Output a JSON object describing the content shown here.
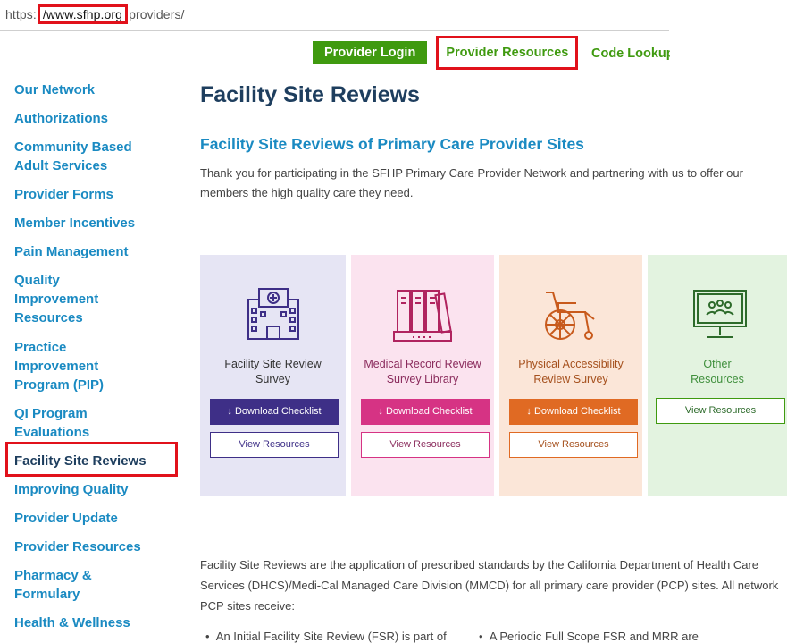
{
  "url": {
    "prefix": "https:",
    "domain": "/www.sfhp.org",
    "path": "providers/"
  },
  "topnav": {
    "login": "Provider Login",
    "resources": "Provider Resources",
    "code_lookup": "Code Lookup"
  },
  "sidebar": {
    "items": [
      "Our Network",
      "Authorizations",
      "Community Based\nAdult Services",
      "Provider Forms",
      "Member Incentives",
      "Pain Management",
      "Quality\nImprovement\nResources",
      "Practice\nImprovement\nProgram (PIP)",
      "QI Program\nEvaluations",
      "Facility Site Reviews",
      "Improving Quality",
      "Provider Update",
      "Provider Resources",
      "Pharmacy &\nFormulary",
      "Health & Wellness"
    ],
    "active": "Facility Site Reviews"
  },
  "main": {
    "title": "Facility Site Reviews",
    "subtitle": "Facility Site Reviews of Primary Care Provider Sites",
    "intro": "Thank you for participating in the SFHP Primary Care Provider Network and partnering with us to offer our members the high quality care they need.",
    "body": "Facility Site Reviews are the application of prescribed standards by the California Department of Health Care Services (DHCS)/Medi-Cal Managed Care Division (MMCD) for all primary care provider (PCP) sites. All network PCP sites receive:",
    "bullets": [
      "An Initial Facility Site Review (FSR) is part of",
      "A Periodic Full Scope FSR and MRR are"
    ]
  },
  "cards": [
    {
      "title": "Facility Site Review\nSurvey",
      "download": "Download Checklist",
      "view": "View Resources",
      "icon": "hospital-icon",
      "color": "#3e2f87"
    },
    {
      "title": "Medical Record Review\nSurvey Library",
      "download": "Download Checklist",
      "view": "View Resources",
      "icon": "binders-icon",
      "color": "#d63384"
    },
    {
      "title": "Physical Accessibility\nReview Survey",
      "download": "Download Checklist",
      "view": "View Resources",
      "icon": "wheelchair-icon",
      "color": "#e06a23"
    },
    {
      "title": "Other\nResources",
      "view": "View Resources",
      "icon": "monitor-people-icon",
      "color": "#3f9a0f"
    }
  ],
  "download_arrow": "↓",
  "bullet_char": "•"
}
